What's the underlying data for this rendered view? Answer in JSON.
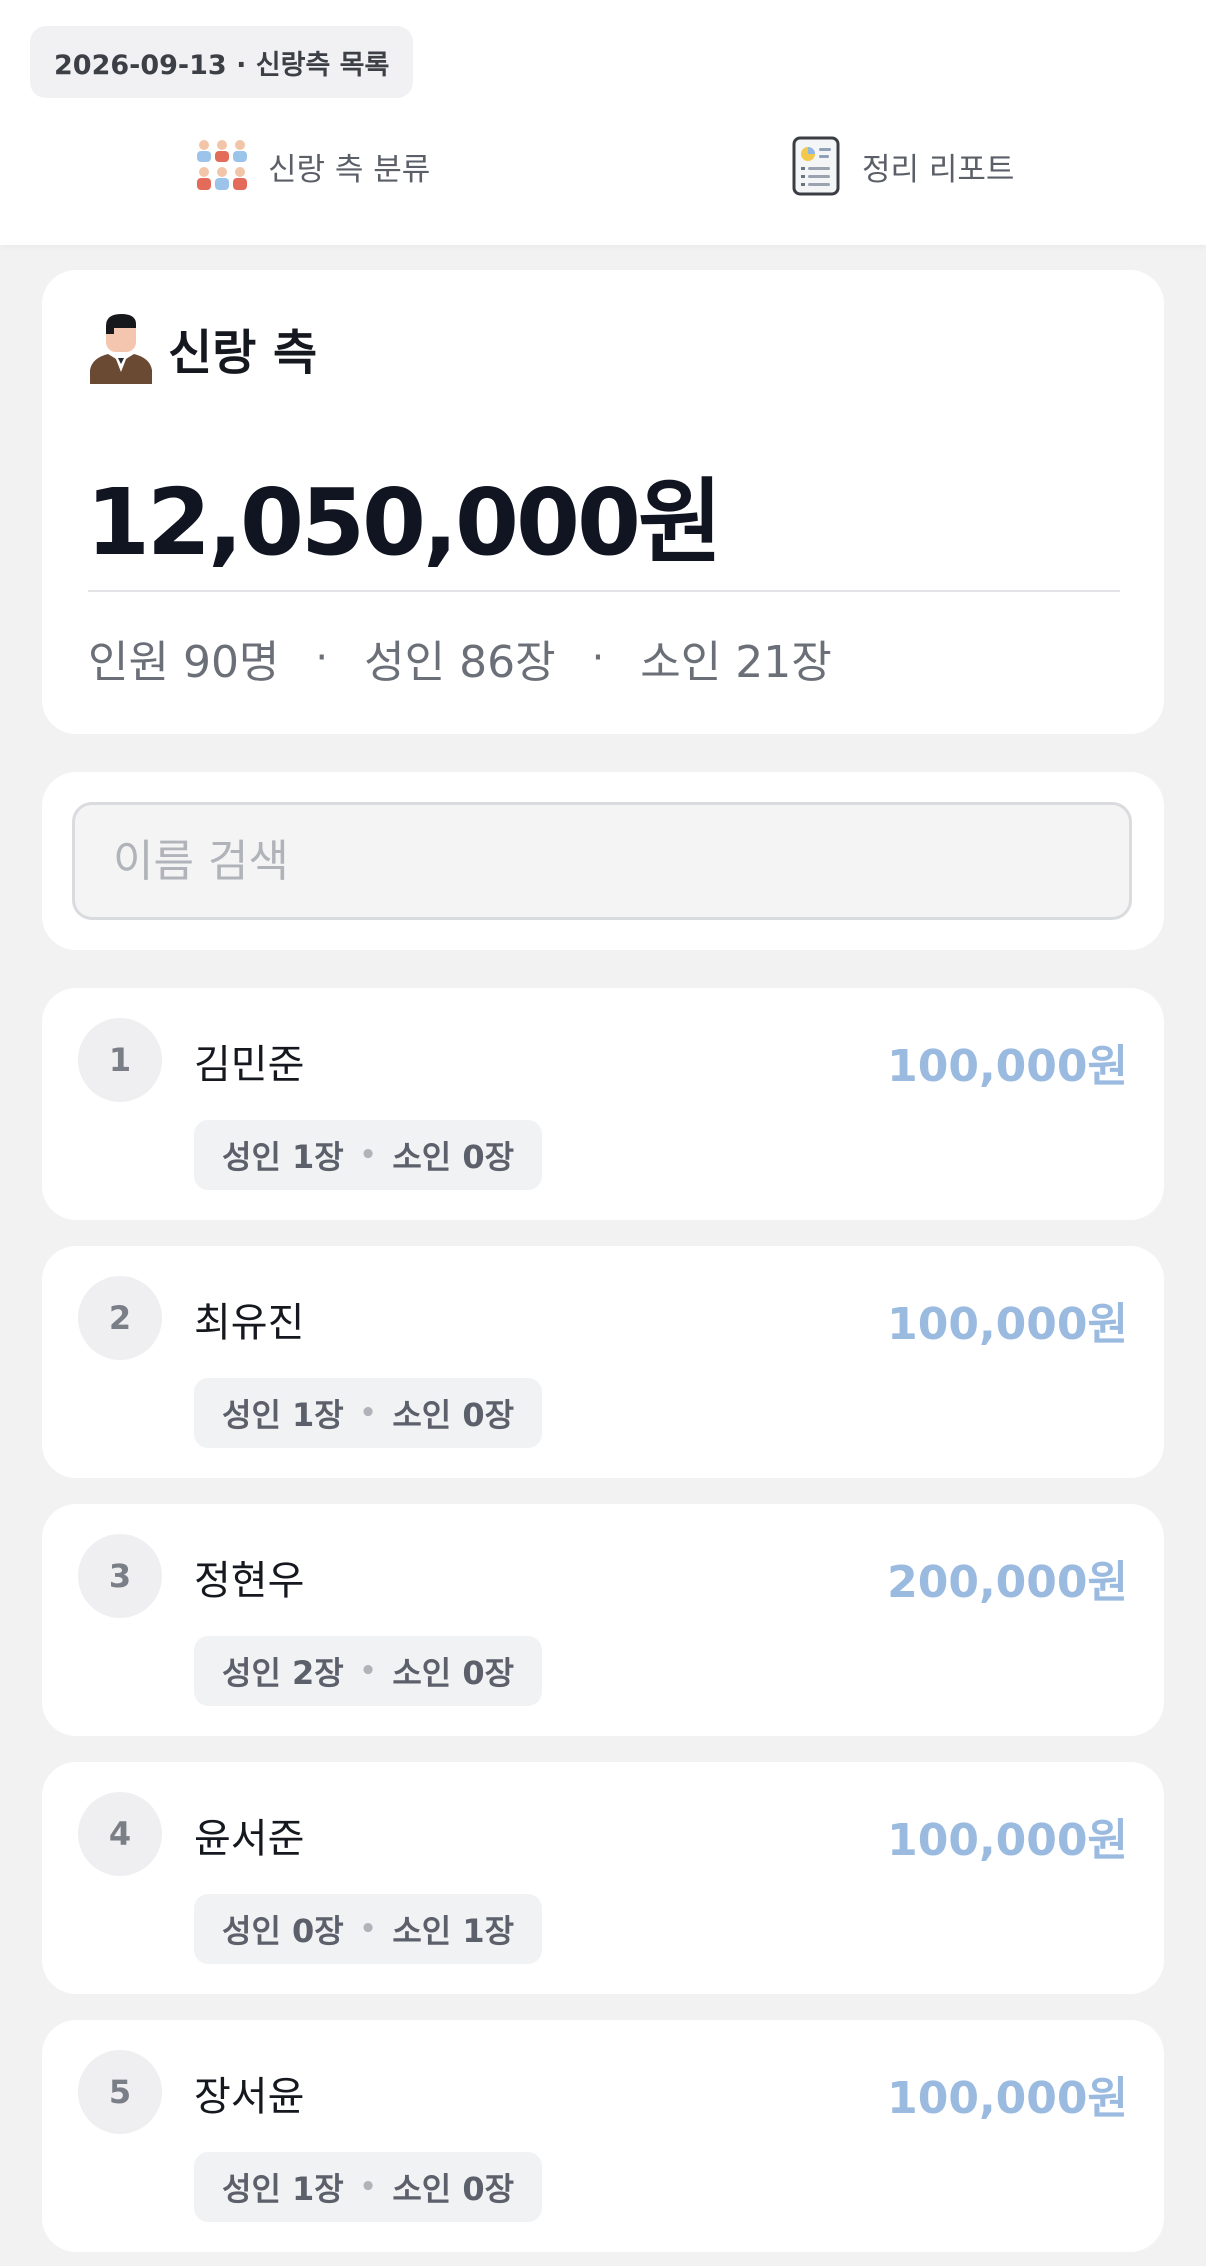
{
  "header": {
    "date_chip": "2026-09-13 · 신랑측 목록",
    "tabs": [
      {
        "label": "신랑 측 분류",
        "icon": "people-group-icon"
      },
      {
        "label": "정리 리포트",
        "icon": "report-document-icon"
      }
    ]
  },
  "summary": {
    "icon": "groom-avatar-icon",
    "title": "신랑 측",
    "total_amount": "12,050,000원",
    "stats": [
      "인원 90명",
      "성인 86장",
      "소인 21장"
    ],
    "separator": "·"
  },
  "search": {
    "placeholder": "이름 검색",
    "value": ""
  },
  "guests": [
    {
      "no": "1",
      "name": "김민준",
      "amount": "100,000원",
      "adult": "성인 1장",
      "child": "소인 0장"
    },
    {
      "no": "2",
      "name": "최유진",
      "amount": "100,000원",
      "adult": "성인 1장",
      "child": "소인 0장"
    },
    {
      "no": "3",
      "name": "정현우",
      "amount": "200,000원",
      "adult": "성인 2장",
      "child": "소인 0장"
    },
    {
      "no": "4",
      "name": "윤서준",
      "amount": "100,000원",
      "adult": "성인 0장",
      "child": "소인 1장"
    },
    {
      "no": "5",
      "name": "장서윤",
      "amount": "100,000원",
      "adult": "성인 1장",
      "child": "소인 0장"
    }
  ],
  "colors": {
    "amount_accent": "#9bbae0",
    "background": "#f2f2f3"
  }
}
